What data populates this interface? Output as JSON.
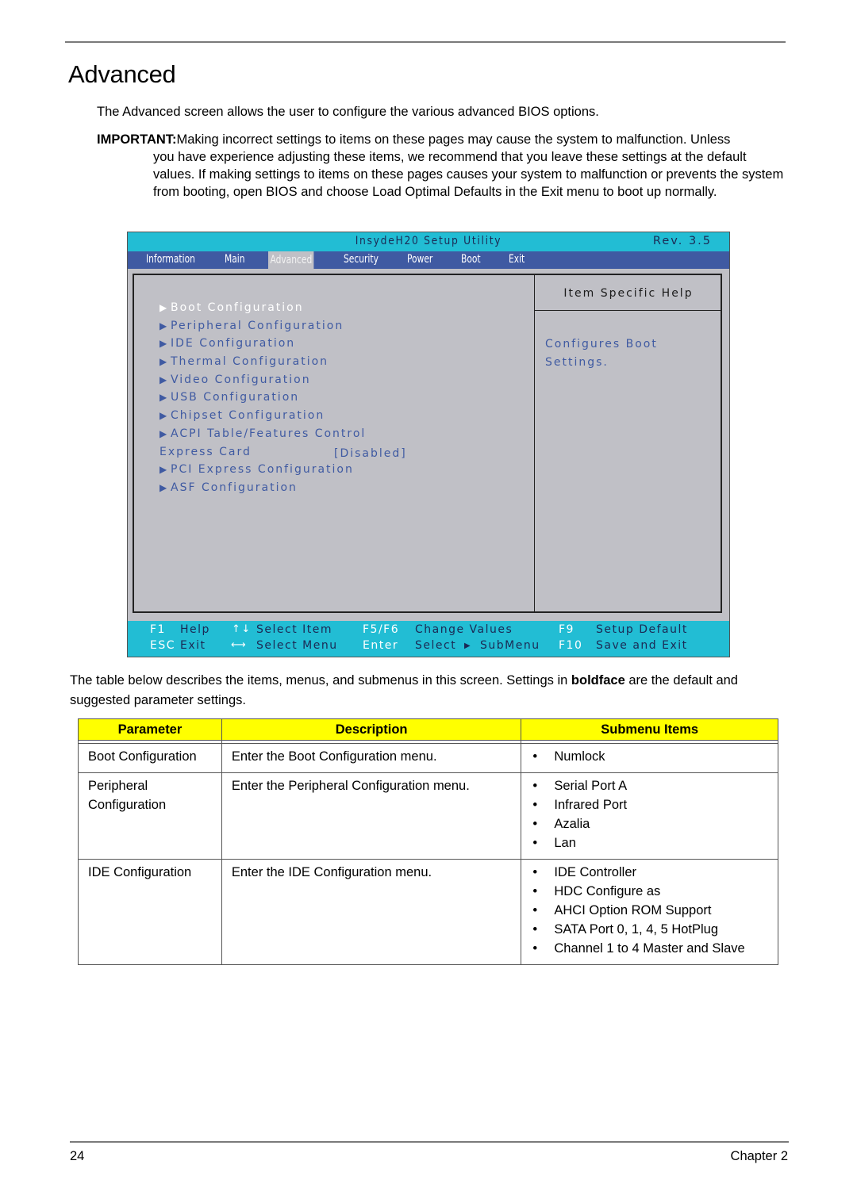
{
  "page": {
    "title": "Advanced",
    "intro": "The Advanced screen allows the user to configure the various advanced BIOS options.",
    "important_label": "IMPORTANT:",
    "important_first": "Making incorrect settings to items on these pages may cause the system to malfunction. Unless",
    "important_cont": "you have experience adjusting these items, we recommend that you leave these settings at the default values. If making settings to items on these pages causes your system to malfunction or prevents the system from booting, open BIOS and choose Load Optimal Defaults in the Exit menu to boot up normally.",
    "table_intro_pre": "The table below describes the items, menus, and submenus in this screen. Settings in ",
    "table_intro_bold": "boldface",
    "table_intro_post": " are the default and suggested parameter settings.",
    "footer_page": "24",
    "footer_chapter": "Chapter 2"
  },
  "bios": {
    "title": "InsydeH20 Setup Utility",
    "rev": "Rev. 3.5",
    "menu": [
      {
        "label": "Information",
        "active": false
      },
      {
        "label": "Main",
        "active": false
      },
      {
        "label": "Advanced",
        "active": true
      },
      {
        "label": "Security",
        "active": false
      },
      {
        "label": "Power",
        "active": false
      },
      {
        "label": "Boot",
        "active": false
      },
      {
        "label": "Exit",
        "active": false
      }
    ],
    "items": [
      {
        "label": "Boot Configuration",
        "submenu": true,
        "selected": true
      },
      {
        "label": "Peripheral Configuration",
        "submenu": true
      },
      {
        "label": "IDE Configuration",
        "submenu": true
      },
      {
        "label": "Thermal Configuration",
        "submenu": true
      },
      {
        "label": "Video Configuration",
        "submenu": true
      },
      {
        "label": "USB Configuration",
        "submenu": true
      },
      {
        "label": "Chipset Configuration",
        "submenu": true
      },
      {
        "label": "ACPI Table/Features Control",
        "submenu": true
      },
      {
        "label": "Express Card",
        "submenu": false,
        "value": "[Disabled]"
      },
      {
        "label": "PCI Express Configuration",
        "submenu": true
      },
      {
        "label": "ASF Configuration",
        "submenu": true
      }
    ],
    "help_title": "Item Specific Help",
    "help_line1": "Configures Boot",
    "help_line2": "Settings.",
    "submenu_arrow": "▶",
    "keys": {
      "f1": "F1",
      "f1_desc": "Help",
      "updown_icon": "↑↓",
      "updown_desc": "Select  Item",
      "f5f6": "F5/F6",
      "f5f6_desc": "Change  Values",
      "f9": "F9",
      "f9_desc": "Setup  Default",
      "esc": "ESC",
      "esc_desc": "Exit",
      "leftright_icon": "⟷",
      "leftright_desc": "Select  Menu",
      "enter": "Enter",
      "enter_desc": "Select",
      "enter_arrow": "▶",
      "enter_desc2": "SubMenu",
      "f10": "F10",
      "f10_desc": "Save  and  Exit"
    },
    "colors": {
      "title_bar": "#22bdd4",
      "menu_bar": "#3f5aa2",
      "panel": "#c0c0c6",
      "item_text": "#3f5aa2"
    }
  },
  "table": {
    "headers": [
      "Parameter",
      "Description",
      "Submenu Items"
    ],
    "header_color": "#ffff00",
    "rows": [
      {
        "parameter": "Boot Configuration",
        "description": "Enter the Boot Configuration menu.",
        "submenu": [
          "Numlock"
        ]
      },
      {
        "parameter": "Peripheral Configuration",
        "description": "Enter the Peripheral Configuration menu.",
        "submenu": [
          "Serial Port A",
          "Infrared Port",
          "Azalia",
          "Lan"
        ]
      },
      {
        "parameter": "IDE Configuration",
        "description": "Enter the IDE Configuration menu.",
        "submenu": [
          "IDE Controller",
          "HDC Configure as",
          "AHCI Option ROM Support",
          "SATA Port 0, 1, 4, 5 HotPlug",
          "Channel 1 to 4 Master and Slave"
        ]
      }
    ]
  }
}
